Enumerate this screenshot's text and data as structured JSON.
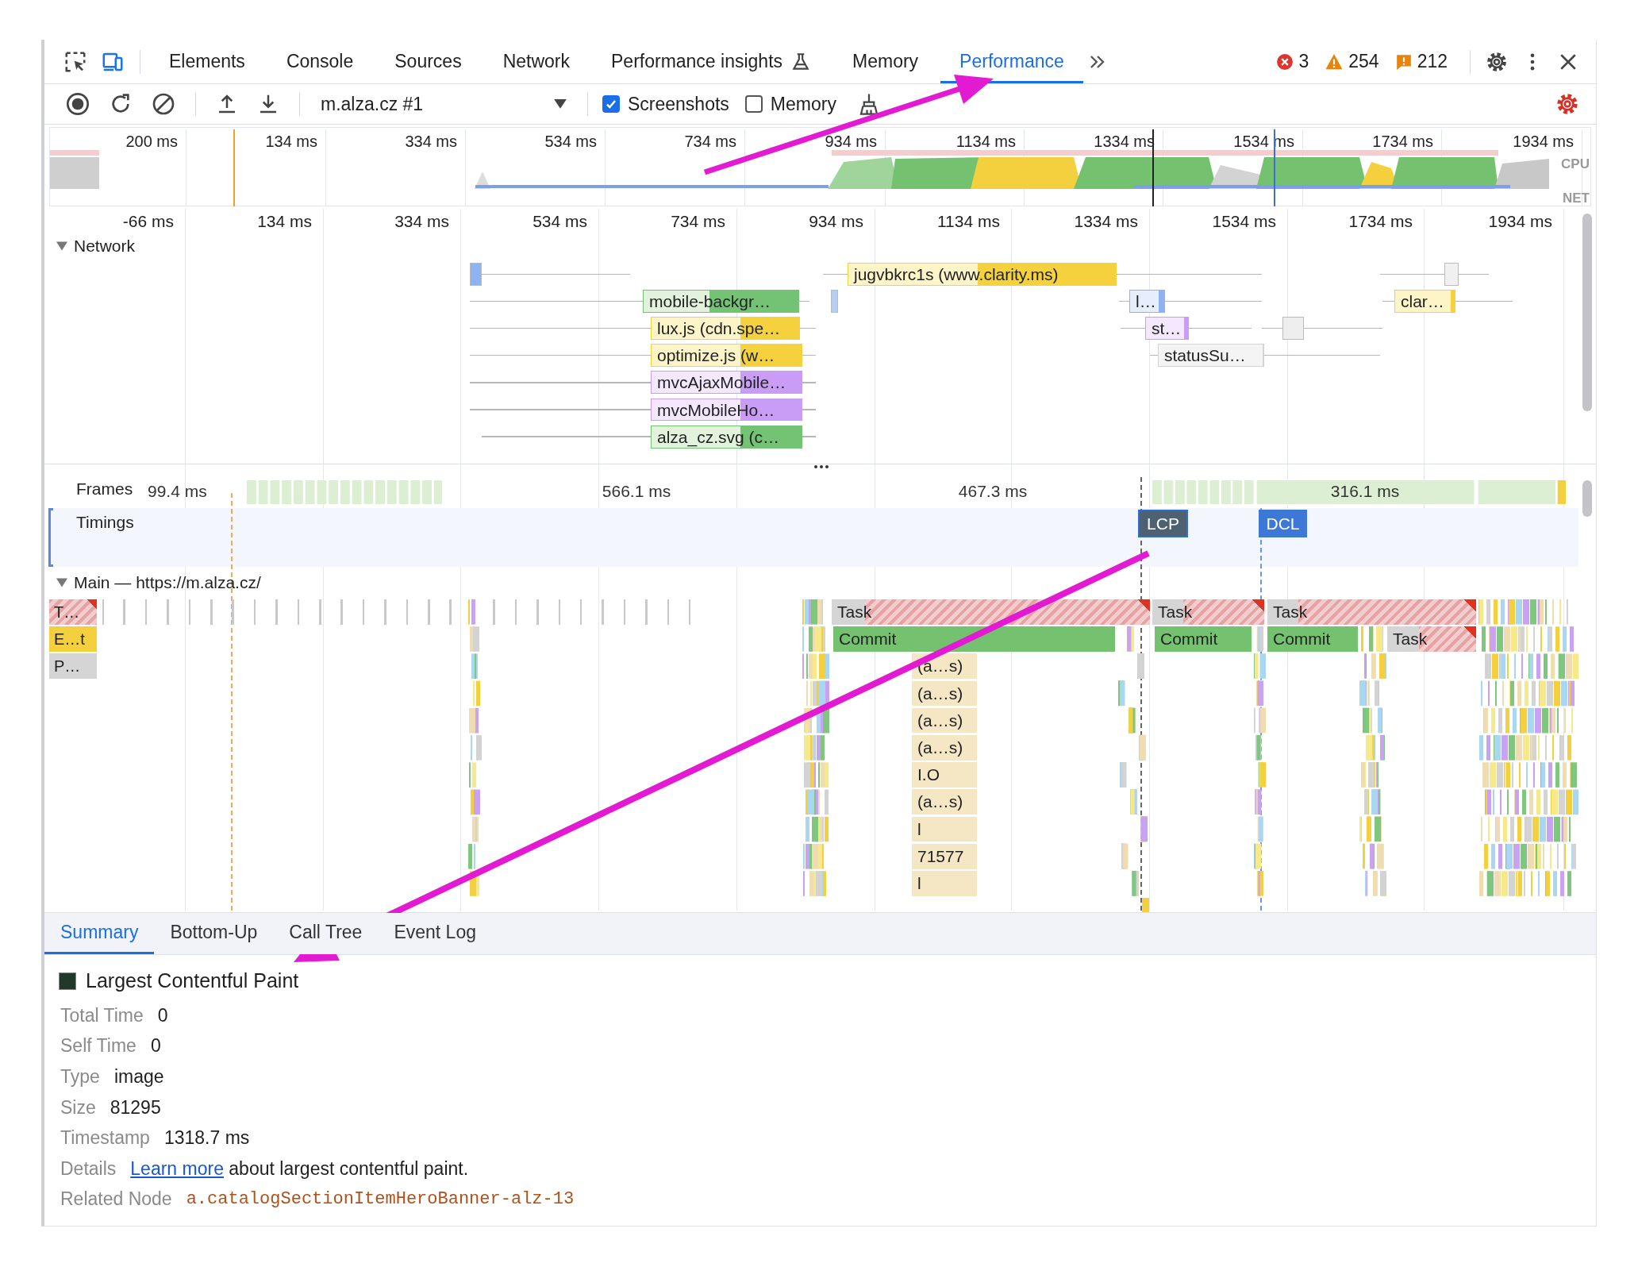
{
  "tabs": [
    {
      "label": "Elements",
      "selected": false,
      "experimental": false
    },
    {
      "label": "Console",
      "selected": false,
      "experimental": false
    },
    {
      "label": "Sources",
      "selected": false,
      "experimental": false
    },
    {
      "label": "Network",
      "selected": false,
      "experimental": false
    },
    {
      "label": "Performance insights",
      "selected": false,
      "experimental": true
    },
    {
      "label": "Memory",
      "selected": false,
      "experimental": false
    },
    {
      "label": "Performance",
      "selected": true,
      "experimental": false
    }
  ],
  "counts": {
    "errors": "3",
    "warnings": "254",
    "issues": "212"
  },
  "recording": {
    "value": "m.alza.cz #1"
  },
  "options": [
    {
      "label": "Screenshots",
      "checked": true
    },
    {
      "label": "Memory",
      "checked": false
    }
  ],
  "overview": {
    "ticks": [
      "200 ms",
      "134 ms",
      "334 ms",
      "534 ms",
      "734 ms",
      "934 ms",
      "1134 ms",
      "1334 ms",
      "1534 ms",
      "1734 ms",
      "1934 ms"
    ],
    "lanes": [
      "CPU",
      "NET"
    ]
  },
  "ruler": [
    "-66 ms",
    "134 ms",
    "334 ms",
    "534 ms",
    "734 ms",
    "934 ms",
    "1134 ms",
    "1334 ms",
    "1534 ms",
    "1734 ms",
    "1934 ms"
  ],
  "network": {
    "title": "Network",
    "expanded": true,
    "requests": [
      {
        "label": "jugvbkrc1s (www.clarity.ms)",
        "kind": "script"
      },
      {
        "label": "mobile-backgr…",
        "kind": "image"
      },
      {
        "label": "lux.js (cdn.spe…",
        "kind": "script"
      },
      {
        "label": "optimize.js (w…",
        "kind": "script"
      },
      {
        "label": "mvcAjaxMobile…",
        "kind": "xhr"
      },
      {
        "label": "mvcMobileHo…",
        "kind": "xhr"
      },
      {
        "label": "alza_cz.svg (c…",
        "kind": "image"
      },
      {
        "label": "l…",
        "kind": "document"
      },
      {
        "label": "st…",
        "kind": "xhr"
      },
      {
        "label": "statusSu…",
        "kind": "other"
      },
      {
        "label": "clar…",
        "kind": "script"
      }
    ]
  },
  "frames": {
    "title": "Frames",
    "durations": [
      "99.4 ms",
      "566.1 ms",
      "467.3 ms",
      "316.1 ms"
    ]
  },
  "timings": {
    "title": "Timings",
    "markers": [
      {
        "label": "LCP",
        "selected": true
      },
      {
        "label": "DCL",
        "selected": false
      }
    ]
  },
  "main": {
    "title": "Main — https://m.alza.cz/",
    "expanded": true,
    "track_labels": [
      "T…",
      "E…t",
      "P…"
    ],
    "events": [
      {
        "label": "Task",
        "kind": "long-task"
      },
      {
        "label": "Task",
        "kind": "long-task"
      },
      {
        "label": "Task",
        "kind": "long-task"
      },
      {
        "label": "Commit",
        "kind": "commit"
      },
      {
        "label": "Commit",
        "kind": "commit"
      },
      {
        "label": "Commit",
        "kind": "commit"
      },
      {
        "label": "Task",
        "kind": "long-task"
      },
      {
        "label": "(a…s)",
        "kind": "function"
      },
      {
        "label": "(a…s)",
        "kind": "function"
      },
      {
        "label": "(a…s)",
        "kind": "function"
      },
      {
        "label": "(a…s)",
        "kind": "function"
      },
      {
        "label": "I.O",
        "kind": "function"
      },
      {
        "label": "(a…s)",
        "kind": "function"
      },
      {
        "label": "l",
        "kind": "function"
      },
      {
        "label": "71577",
        "kind": "function"
      },
      {
        "label": "l",
        "kind": "function"
      }
    ]
  },
  "bottom_tabs": [
    {
      "label": "Summary",
      "selected": true
    },
    {
      "label": "Bottom-Up",
      "selected": false
    },
    {
      "label": "Call Tree",
      "selected": false
    },
    {
      "label": "Event Log",
      "selected": false
    }
  ],
  "summary": {
    "title": "Largest Contentful Paint",
    "rows": [
      {
        "label": "Total Time",
        "value": "0",
        "kind": "text"
      },
      {
        "label": "Self Time",
        "value": "0",
        "kind": "text"
      },
      {
        "label": "Type",
        "value": "image",
        "kind": "text"
      },
      {
        "label": "Size",
        "value": "81295",
        "kind": "text"
      },
      {
        "label": "Timestamp",
        "value": "1318.7 ms",
        "kind": "text"
      },
      {
        "label": "Details",
        "link": "Learn more",
        "value": " about largest contentful paint.",
        "kind": "link"
      },
      {
        "label": "Related Node",
        "value": "a.catalogSectionItemHeroBanner-alz-13",
        "kind": "node"
      }
    ]
  }
}
